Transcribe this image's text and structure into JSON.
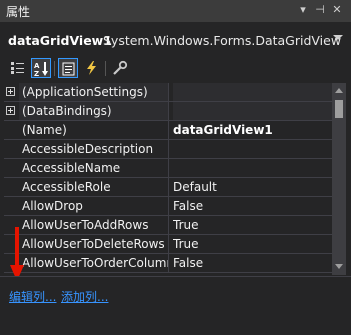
{
  "titlebar": {
    "title": "属性",
    "buttons": [
      "▾",
      "⊣",
      "✕"
    ]
  },
  "object_selector": {
    "name": "dataGridView1",
    "type": "System.Windows.Forms.DataGridView"
  },
  "toolbar": {
    "tools": [
      {
        "name": "categorized-icon",
        "active": false
      },
      {
        "name": "alphabetical-icon",
        "active": true
      },
      {
        "name": "properties-icon",
        "active": true
      },
      {
        "name": "events-icon",
        "active": false
      },
      {
        "name": "property-pages-icon",
        "active": false
      }
    ]
  },
  "properties": [
    {
      "name": "(ApplicationSettings)",
      "value": "",
      "expandable": true,
      "category": true
    },
    {
      "name": "(DataBindings)",
      "value": "",
      "expandable": true,
      "category": true
    },
    {
      "name": "(Name)",
      "value": "dataGridView1",
      "bold": true
    },
    {
      "name": "AccessibleDescription",
      "value": ""
    },
    {
      "name": "AccessibleName",
      "value": ""
    },
    {
      "name": "AccessibleRole",
      "value": "Default"
    },
    {
      "name": "AllowDrop",
      "value": "False"
    },
    {
      "name": "AllowUserToAddRows",
      "value": "True"
    },
    {
      "name": "AllowUserToDeleteRows",
      "value": "True"
    },
    {
      "name": "AllowUserToOrderColumns",
      "value": "False"
    }
  ],
  "commands": {
    "edit_columns": "编辑列...",
    "add_column": "添加列..."
  },
  "colors": {
    "background": "#252526",
    "link": "#3794ff",
    "arrow": "#e51400",
    "active_border": "#3399ff"
  }
}
